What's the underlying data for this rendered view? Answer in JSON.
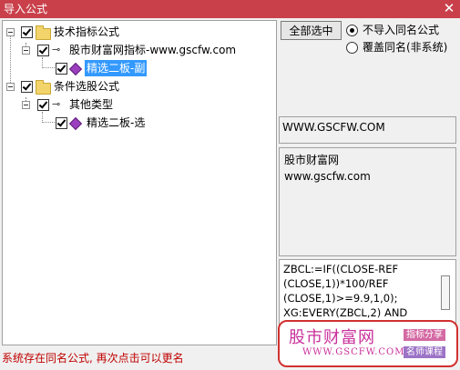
{
  "window": {
    "title": "导入公式",
    "close_glyph": "✕"
  },
  "tree": {
    "nodes": [
      {
        "label": "技术指标公式",
        "icon": "folder-icon",
        "checked": true
      },
      {
        "label": "股市财富网指标-www.gscfw.com",
        "icon": "key-icon",
        "checked": true
      },
      {
        "label": "精选二板-副",
        "icon": "formula-gem-icon",
        "checked": true,
        "selected": true
      },
      {
        "label": "条件选股公式",
        "icon": "folder-icon",
        "checked": true
      },
      {
        "label": "其他类型",
        "icon": "key-icon",
        "checked": true
      },
      {
        "label": "精选二板-选",
        "icon": "formula-gem-icon",
        "checked": true
      }
    ]
  },
  "options": {
    "select_all_label": "全部选中",
    "radio_no_import": "不导入同名公式",
    "radio_overwrite": "覆盖同名(非系统)",
    "selected_radio": "no_import"
  },
  "site_text": "WWW.GSCFW.COM",
  "note": {
    "line1": "股市财富网",
    "line2": "www.gscfw.com"
  },
  "code": {
    "line1": "ZBCL:=IF((CLOSE-REF",
    "line2": "(CLOSE,1))*100/REF",
    "line3": "(CLOSE,1)>=9.9,1,0);",
    "line4": "XG:EVERY(ZBCL,2) AND"
  },
  "status_text": "系统存在同名公式, 再次点击可以更名",
  "watermark": {
    "brand": "股市财富网",
    "url": "WWW.GSCFW.COM",
    "tag1": "指标分享",
    "tag2": "名师课程"
  },
  "colors": {
    "titlebar": "#c9404a",
    "selection": "#3399ff",
    "status": "#c00000",
    "watermark": "#c9309a"
  }
}
